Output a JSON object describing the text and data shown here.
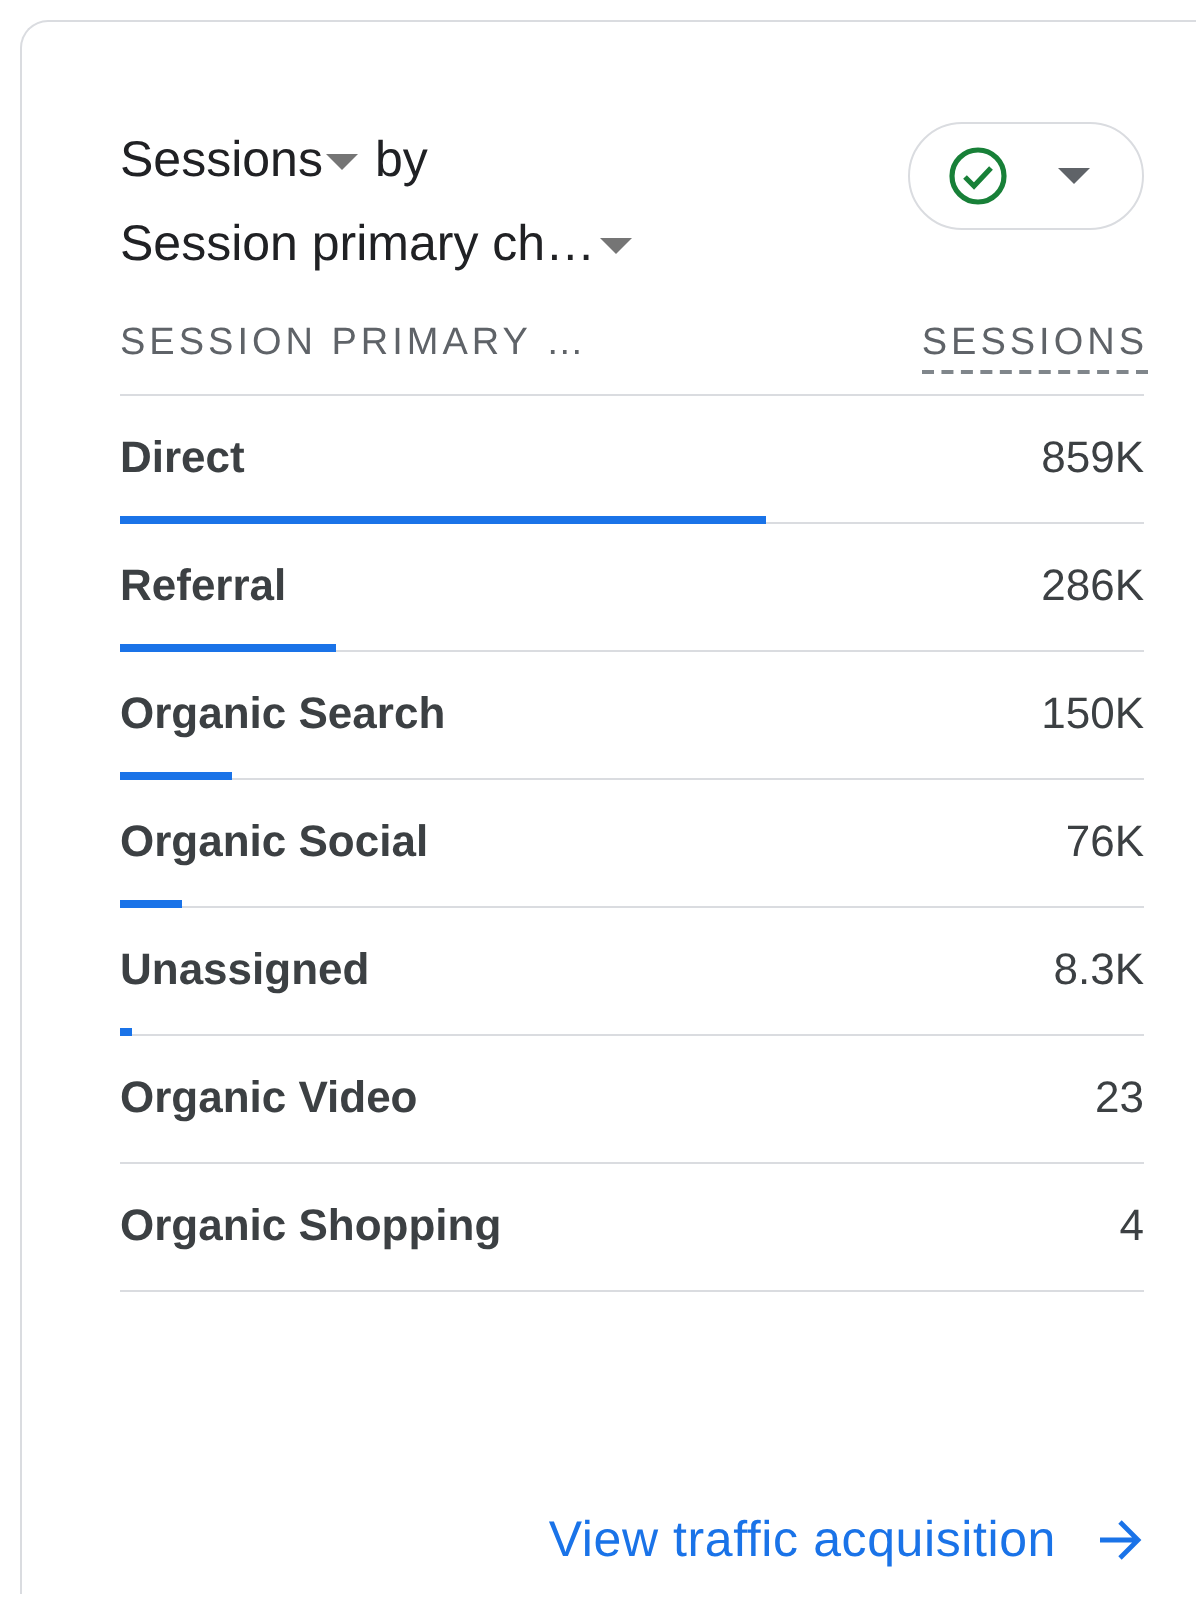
{
  "card": {
    "metric": "Sessions",
    "connector": "by",
    "dimension": "Session primary ch…",
    "columns": [
      "SESSION PRIMARY …",
      "SESSIONS"
    ],
    "rows": [
      {
        "label": "Direct",
        "value": "859K",
        "level": 0.63
      },
      {
        "label": "Referral",
        "value": "286K",
        "level": 0.21
      },
      {
        "label": "Organic Search",
        "value": "150K",
        "level": 0.11
      },
      {
        "label": "Organic Social",
        "value": "76K",
        "level": 0.06
      },
      {
        "label": "Unassigned",
        "value": "8.3K",
        "level": 0.012
      },
      {
        "label": "Organic Video",
        "value": "23"
      },
      {
        "label": "Organic Shopping",
        "value": "4"
      }
    ],
    "link": "View traffic acquisition"
  }
}
